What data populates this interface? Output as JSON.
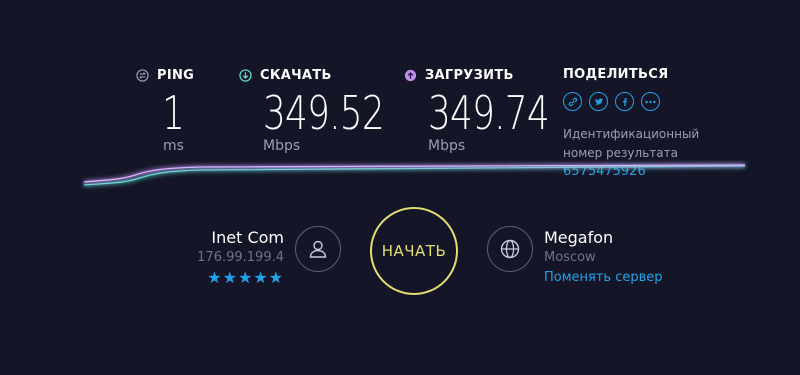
{
  "ping": {
    "label": "PING",
    "value": "1",
    "unit": "ms",
    "icon": "ping-icon"
  },
  "download": {
    "label": "СКАЧАТЬ",
    "value": "349.52",
    "unit": "Mbps",
    "icon": "download-icon",
    "color": "#5ee0d0"
  },
  "upload": {
    "label": "ЗАГРУЗИТЬ",
    "value": "349.74",
    "unit": "Mbps",
    "icon": "upload-icon",
    "color": "#c58cf0"
  },
  "share": {
    "label": "ПОДЕЛИТЬСЯ",
    "buttons": [
      {
        "icon": "link-icon",
        "glyph": "⛓"
      },
      {
        "icon": "twitter-icon",
        "glyph": "t"
      },
      {
        "icon": "facebook-icon",
        "glyph": "f"
      },
      {
        "icon": "more-icon",
        "glyph": "•••"
      }
    ],
    "result_label": "Идентификационный номер результата",
    "result_id": "6575475926"
  },
  "isp": {
    "name": "Inet Com",
    "ip": "176.99.199.4",
    "rating": 5,
    "stars": "★★★★★"
  },
  "start_button": {
    "label": "НАЧАТЬ"
  },
  "server": {
    "name": "Megafon",
    "city": "Moscow",
    "change_label": "Поменять сервер"
  },
  "colors": {
    "background": "#141628",
    "accent": "#1fa3e8",
    "start": "#e3dd70"
  }
}
